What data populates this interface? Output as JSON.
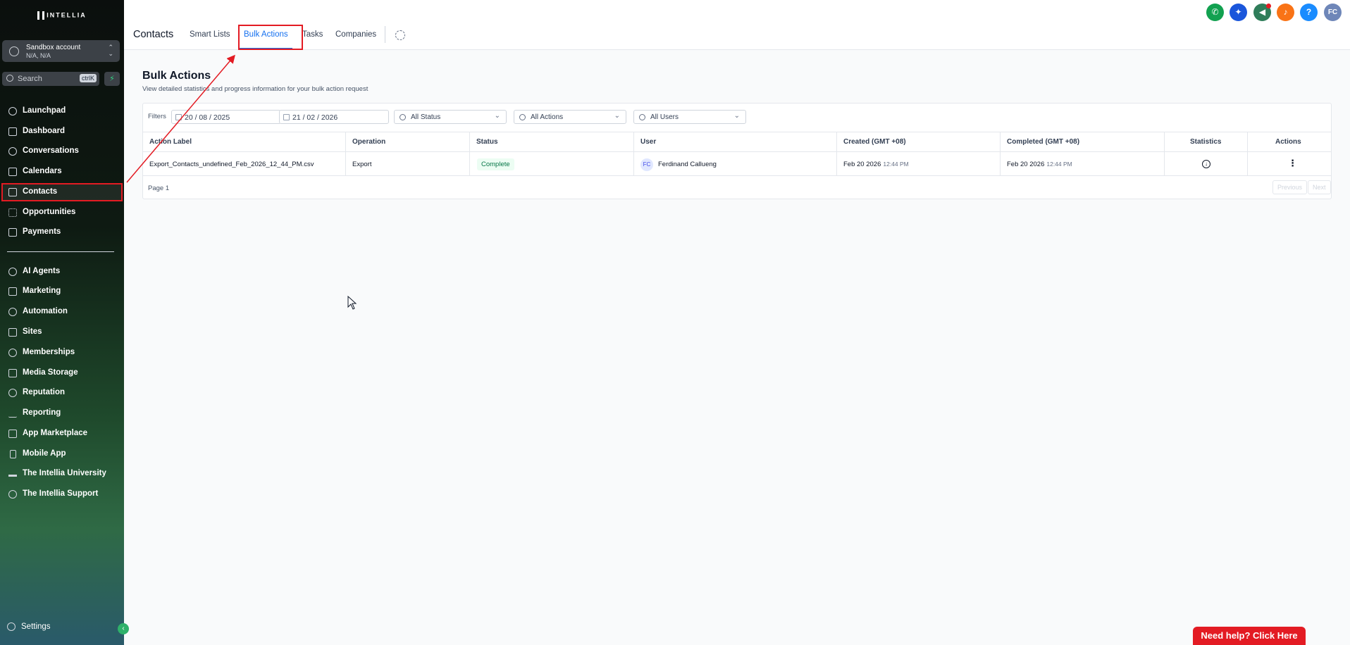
{
  "brand": {
    "logo_text": "INTELLIA"
  },
  "account": {
    "name": "Sandbox account",
    "location": "N/A, N/A"
  },
  "sidebar_search": {
    "placeholder": "Search",
    "shortcut": "ctrlK"
  },
  "sidebar": {
    "items": [
      {
        "label": "Launchpad",
        "icon": "rocket-icon"
      },
      {
        "label": "Dashboard",
        "icon": "grid-icon"
      },
      {
        "label": "Conversations",
        "icon": "chat-icon"
      },
      {
        "label": "Calendars",
        "icon": "calendar-icon"
      },
      {
        "label": "Contacts",
        "icon": "contacts-icon",
        "active": true
      },
      {
        "label": "Opportunities",
        "icon": "opportunities-icon"
      },
      {
        "label": "Payments",
        "icon": "payments-icon"
      },
      {
        "label": "AI Agents",
        "icon": "sparkle-icon"
      },
      {
        "label": "Marketing",
        "icon": "send-icon"
      },
      {
        "label": "Automation",
        "icon": "automation-icon"
      },
      {
        "label": "Sites",
        "icon": "globe-icon"
      },
      {
        "label": "Memberships",
        "icon": "award-icon"
      },
      {
        "label": "Media Storage",
        "icon": "image-icon"
      },
      {
        "label": "Reputation",
        "icon": "star-icon"
      },
      {
        "label": "Reporting",
        "icon": "trend-icon"
      },
      {
        "label": "App Marketplace",
        "icon": "apps-icon"
      },
      {
        "label": "Mobile App",
        "icon": "phone-icon"
      },
      {
        "label": "The Intellia University",
        "icon": "graduation-cap-icon"
      },
      {
        "label": "The Intellia Support",
        "icon": "support-icon"
      }
    ],
    "settings_label": "Settings"
  },
  "header": {
    "title": "Contacts",
    "tabs": [
      {
        "label": "Smart Lists"
      },
      {
        "label": "Bulk Actions",
        "active": true
      },
      {
        "label": "Tasks"
      },
      {
        "label": "Companies"
      }
    ],
    "user_initials": "FC",
    "help_symbol": "?",
    "accent_colors": {
      "phone": "#12a150",
      "ai": "#1a56db",
      "announce": "#2f7d5a",
      "bell": "#f97316",
      "help": "#1a8cff",
      "avatar": "#6e86b8"
    }
  },
  "main": {
    "title": "Bulk Actions",
    "subtitle": "View detailed statistics and progress information for your bulk action request",
    "filters": {
      "label": "Filters",
      "start_date": "20 / 08 / 2025",
      "end_date": "21 / 02 / 2026",
      "status": "All Status",
      "actions": "All Actions",
      "users": "All Users"
    },
    "table": {
      "columns": [
        "Action Label",
        "Operation",
        "Status",
        "User",
        "Created (GMT +08)",
        "Completed (GMT +08)",
        "Statistics",
        "Actions"
      ],
      "rows": [
        {
          "action_label": "Export_Contacts_undefined_Feb_2026_12_44_PM.csv",
          "operation": "Export",
          "status": "Complete",
          "user_initials": "FC",
          "user": "Ferdinand Callueng",
          "created_date": "Feb 20 2026",
          "created_time": "12:44 PM",
          "completed_date": "Feb 20 2026",
          "completed_time": "12:44 PM"
        }
      ]
    },
    "pagination": {
      "page": "Page 1",
      "previous": "Previous",
      "next": "Next"
    }
  },
  "help_button": "Need help? Click Here"
}
